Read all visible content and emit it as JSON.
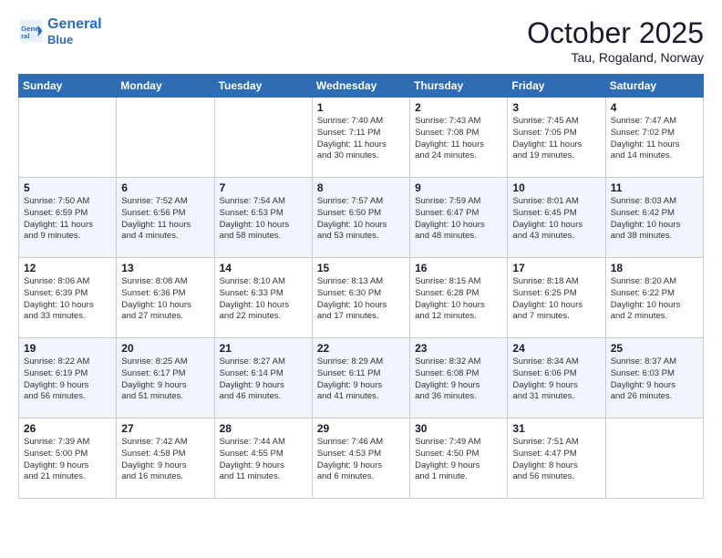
{
  "header": {
    "logo_line1": "General",
    "logo_line2": "Blue",
    "month": "October 2025",
    "location": "Tau, Rogaland, Norway"
  },
  "days_of_week": [
    "Sunday",
    "Monday",
    "Tuesday",
    "Wednesday",
    "Thursday",
    "Friday",
    "Saturday"
  ],
  "weeks": [
    [
      {
        "day": "",
        "info": ""
      },
      {
        "day": "",
        "info": ""
      },
      {
        "day": "",
        "info": ""
      },
      {
        "day": "1",
        "info": "Sunrise: 7:40 AM\nSunset: 7:11 PM\nDaylight: 11 hours\nand 30 minutes."
      },
      {
        "day": "2",
        "info": "Sunrise: 7:43 AM\nSunset: 7:08 PM\nDaylight: 11 hours\nand 24 minutes."
      },
      {
        "day": "3",
        "info": "Sunrise: 7:45 AM\nSunset: 7:05 PM\nDaylight: 11 hours\nand 19 minutes."
      },
      {
        "day": "4",
        "info": "Sunrise: 7:47 AM\nSunset: 7:02 PM\nDaylight: 11 hours\nand 14 minutes."
      }
    ],
    [
      {
        "day": "5",
        "info": "Sunrise: 7:50 AM\nSunset: 6:59 PM\nDaylight: 11 hours\nand 9 minutes."
      },
      {
        "day": "6",
        "info": "Sunrise: 7:52 AM\nSunset: 6:56 PM\nDaylight: 11 hours\nand 4 minutes."
      },
      {
        "day": "7",
        "info": "Sunrise: 7:54 AM\nSunset: 6:53 PM\nDaylight: 10 hours\nand 58 minutes."
      },
      {
        "day": "8",
        "info": "Sunrise: 7:57 AM\nSunset: 6:50 PM\nDaylight: 10 hours\nand 53 minutes."
      },
      {
        "day": "9",
        "info": "Sunrise: 7:59 AM\nSunset: 6:47 PM\nDaylight: 10 hours\nand 48 minutes."
      },
      {
        "day": "10",
        "info": "Sunrise: 8:01 AM\nSunset: 6:45 PM\nDaylight: 10 hours\nand 43 minutes."
      },
      {
        "day": "11",
        "info": "Sunrise: 8:03 AM\nSunset: 6:42 PM\nDaylight: 10 hours\nand 38 minutes."
      }
    ],
    [
      {
        "day": "12",
        "info": "Sunrise: 8:06 AM\nSunset: 6:39 PM\nDaylight: 10 hours\nand 33 minutes."
      },
      {
        "day": "13",
        "info": "Sunrise: 8:08 AM\nSunset: 6:36 PM\nDaylight: 10 hours\nand 27 minutes."
      },
      {
        "day": "14",
        "info": "Sunrise: 8:10 AM\nSunset: 6:33 PM\nDaylight: 10 hours\nand 22 minutes."
      },
      {
        "day": "15",
        "info": "Sunrise: 8:13 AM\nSunset: 6:30 PM\nDaylight: 10 hours\nand 17 minutes."
      },
      {
        "day": "16",
        "info": "Sunrise: 8:15 AM\nSunset: 6:28 PM\nDaylight: 10 hours\nand 12 minutes."
      },
      {
        "day": "17",
        "info": "Sunrise: 8:18 AM\nSunset: 6:25 PM\nDaylight: 10 hours\nand 7 minutes."
      },
      {
        "day": "18",
        "info": "Sunrise: 8:20 AM\nSunset: 6:22 PM\nDaylight: 10 hours\nand 2 minutes."
      }
    ],
    [
      {
        "day": "19",
        "info": "Sunrise: 8:22 AM\nSunset: 6:19 PM\nDaylight: 9 hours\nand 56 minutes."
      },
      {
        "day": "20",
        "info": "Sunrise: 8:25 AM\nSunset: 6:17 PM\nDaylight: 9 hours\nand 51 minutes."
      },
      {
        "day": "21",
        "info": "Sunrise: 8:27 AM\nSunset: 6:14 PM\nDaylight: 9 hours\nand 46 minutes."
      },
      {
        "day": "22",
        "info": "Sunrise: 8:29 AM\nSunset: 6:11 PM\nDaylight: 9 hours\nand 41 minutes."
      },
      {
        "day": "23",
        "info": "Sunrise: 8:32 AM\nSunset: 6:08 PM\nDaylight: 9 hours\nand 36 minutes."
      },
      {
        "day": "24",
        "info": "Sunrise: 8:34 AM\nSunset: 6:06 PM\nDaylight: 9 hours\nand 31 minutes."
      },
      {
        "day": "25",
        "info": "Sunrise: 8:37 AM\nSunset: 6:03 PM\nDaylight: 9 hours\nand 26 minutes."
      }
    ],
    [
      {
        "day": "26",
        "info": "Sunrise: 7:39 AM\nSunset: 5:00 PM\nDaylight: 9 hours\nand 21 minutes."
      },
      {
        "day": "27",
        "info": "Sunrise: 7:42 AM\nSunset: 4:58 PM\nDaylight: 9 hours\nand 16 minutes."
      },
      {
        "day": "28",
        "info": "Sunrise: 7:44 AM\nSunset: 4:55 PM\nDaylight: 9 hours\nand 11 minutes."
      },
      {
        "day": "29",
        "info": "Sunrise: 7:46 AM\nSunset: 4:53 PM\nDaylight: 9 hours\nand 6 minutes."
      },
      {
        "day": "30",
        "info": "Sunrise: 7:49 AM\nSunset: 4:50 PM\nDaylight: 9 hours\nand 1 minute."
      },
      {
        "day": "31",
        "info": "Sunrise: 7:51 AM\nSunset: 4:47 PM\nDaylight: 8 hours\nand 56 minutes."
      },
      {
        "day": "",
        "info": ""
      }
    ]
  ]
}
